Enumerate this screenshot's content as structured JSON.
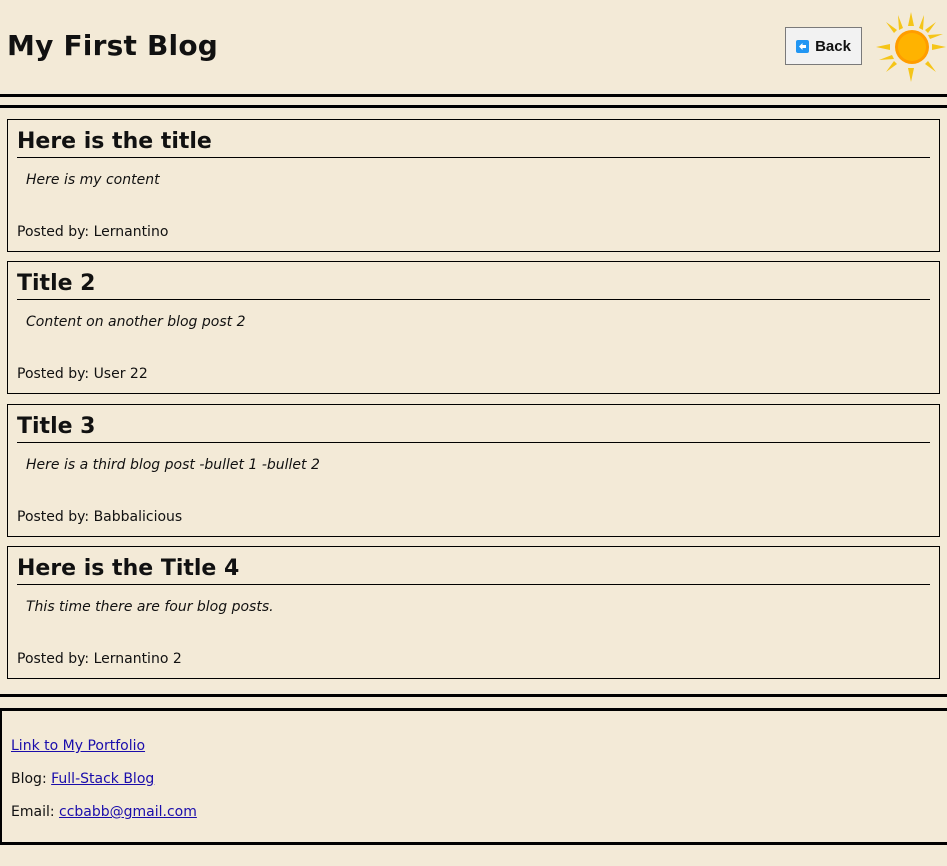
{
  "header": {
    "title": "My First Blog",
    "back_label": "Back"
  },
  "posts": [
    {
      "title": "Here is the title",
      "content": "Here is my content",
      "author": "Posted by: Lernantino"
    },
    {
      "title": "Title 2",
      "content": "Content on another blog post 2",
      "author": "Posted by: User 22"
    },
    {
      "title": "Title 3",
      "content": "Here is a third blog post -bullet 1 -bullet 2",
      "author": "Posted by: Babbalicious"
    },
    {
      "title": "Here is the Title 4",
      "content": "This time there are four blog posts.",
      "author": "Posted by: Lernantino 2"
    }
  ],
  "footer": {
    "portfolio_link": "Link to My Portfolio",
    "blog_label": "Blog: ",
    "blog_link": "Full-Stack Blog",
    "email_label": "Email: ",
    "email_link": "ccbabb@gmail.com"
  },
  "icons": {
    "back": "back-arrow-icon",
    "theme": "sun-icon"
  },
  "colors": {
    "background": "#f3ead7",
    "link": "#1a0dab",
    "sun": "#ffb300",
    "back_icon": "#2196f3"
  }
}
